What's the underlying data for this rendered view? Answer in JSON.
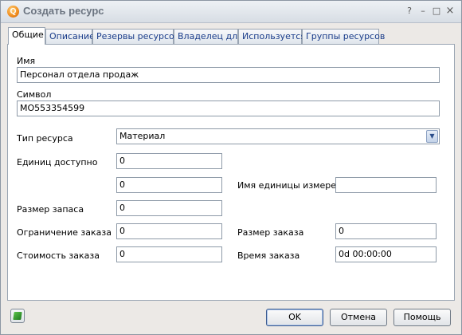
{
  "window": {
    "title": "Создать ресурс",
    "app_icon_letter": "Q",
    "help_glyph": "?",
    "minimize_glyph": "–",
    "maximize_glyph": "□",
    "close_glyph": "×"
  },
  "tabs": [
    {
      "label": "Общие",
      "active": true
    },
    {
      "label": "Описание",
      "active": false
    },
    {
      "label": "Резервы ресурсов",
      "active": false
    },
    {
      "label": "Владелец для",
      "active": false
    },
    {
      "label": "Используется",
      "active": false
    },
    {
      "label": "Группы ресурсов",
      "active": false
    }
  ],
  "form": {
    "name_label": "Имя",
    "name_value": "Персонал отдела продаж",
    "symbol_label": "Символ",
    "symbol_value": "MO553354599",
    "type_label": "Тип ресурса",
    "type_value": "Материал",
    "units_available_label": "Единиц доступно",
    "units_available_value": "0",
    "units_second_value": "0",
    "unit_name_label": "Имя единицы измерения",
    "unit_name_value": "",
    "stock_size_label": "Размер запаса",
    "stock_size_value": "0",
    "order_limit_label": "Ограничение заказа",
    "order_limit_value": "0",
    "order_size_label": "Размер заказа",
    "order_size_value": "0",
    "order_cost_label": "Стоимость заказа",
    "order_cost_value": "0",
    "order_time_label": "Время заказа",
    "order_time_value": "0d 00:00:00"
  },
  "buttons": {
    "ok": "OK",
    "cancel": "Отмена",
    "help": "Помощь"
  },
  "icons": {
    "app": "app-logo-icon",
    "footer": "book-icon",
    "dropdown": "chevron-down-icon"
  }
}
